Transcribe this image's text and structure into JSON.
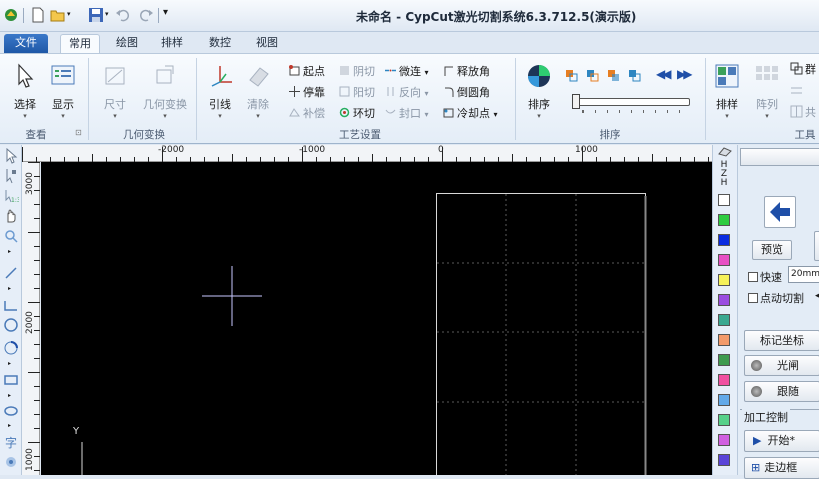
{
  "window": {
    "title": "未命名 - CypCut激光切割系统6.3.712.5(演示版)"
  },
  "quick_access": [
    "app-icon",
    "new-icon",
    "open-icon",
    "save-icon",
    "undo-icon",
    "redo-icon",
    "customize-icon"
  ],
  "tabs": [
    {
      "label": "文件"
    },
    {
      "label": "常用"
    },
    {
      "label": "绘图"
    },
    {
      "label": "排样"
    },
    {
      "label": "数控"
    },
    {
      "label": "视图"
    }
  ],
  "ribbon": {
    "view_group": {
      "label": "查看",
      "select": "选择",
      "display": "显示"
    },
    "geom_group": {
      "label": "几何变换",
      "size": "尺寸",
      "transform": "几何变换"
    },
    "process_group": {
      "label": "工艺设置",
      "lead": "引线",
      "clear": "清除",
      "start_point": "起点",
      "stop_point": "停靠",
      "compensate": "补偿",
      "negative_cut": "阴切",
      "positive_cut": "阳切",
      "ring_cut": "环切",
      "micro_joint": "微连",
      "reverse": "反向",
      "seal": "封口",
      "release_angle": "释放角",
      "round_corner": "倒圆角",
      "cooling_point": "冷却点"
    },
    "sort_group": {
      "label": "排序",
      "sort": "排序"
    },
    "tools_group": {
      "label": "工具",
      "nest": "排样",
      "array": "阵列",
      "group": "群",
      "share": "共"
    }
  },
  "ruler": {
    "h_labels": [
      "-2000",
      "-1000",
      "0",
      "1000"
    ],
    "v_labels": [
      "3000",
      "2000",
      "1000"
    ]
  },
  "canvas": {
    "axis_label": "Y"
  },
  "layer_colors": [
    "#ffffff",
    "#2ecc40",
    "#0a2be0",
    "#e74fc4",
    "#f5f15a",
    "#9b4de0",
    "#3aa890",
    "#f29a6a",
    "#3f9b4f",
    "#f04fa0",
    "#63a9e8",
    "#57d089",
    "#d05fe0",
    "#5a44d8"
  ],
  "right_panel": {
    "preview": "预览",
    "fast": "快速",
    "speed_value": "20mm/",
    "jog_cut": "点动切割",
    "mark_coord": "标记坐标",
    "shutter": "光闸",
    "follow": "跟随",
    "process_control": "加工控制",
    "start": "开始*",
    "walk_border": "走边框"
  }
}
